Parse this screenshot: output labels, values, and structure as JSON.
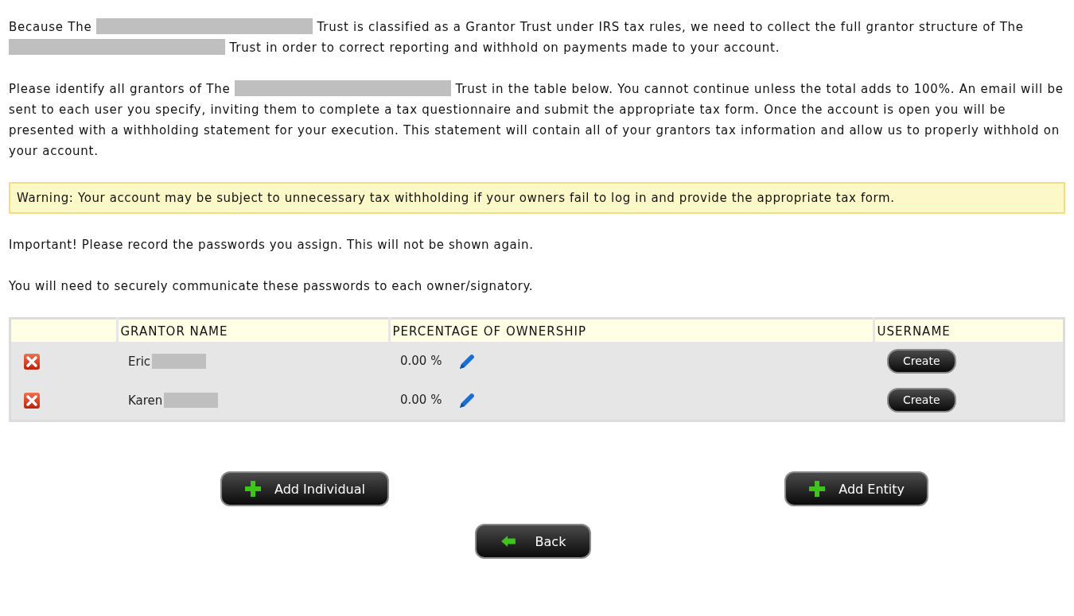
{
  "paragraphs": [
    {
      "segments": [
        {
          "kind": "text",
          "text": "Because The"
        },
        {
          "kind": "redaction"
        },
        {
          "kind": "text",
          "text": "Trust is classified as a Grantor Trust under IRS tax rules, we need to collect the full grantor structure of The"
        },
        {
          "kind": "redaction"
        },
        {
          "kind": "text",
          "text": "Trust in order to correct reporting and withhold on payments made to your account."
        }
      ]
    },
    {
      "segments": [
        {
          "kind": "text",
          "text": "Please identify all grantors of The"
        },
        {
          "kind": "redaction"
        },
        {
          "kind": "text",
          "text": "Trust in the table below. You cannot continue unless the total adds to 100%. An email will be sent to each user you specify, inviting them to complete a tax questionnaire and submit the appropriate tax form. Once the account is open you will be presented with a withholding statement for your execution. This statement will contain all of your grantors tax information and allow us to properly withhold on your account."
        }
      ]
    }
  ],
  "warning": "Warning: Your account may be subject to unnecessary tax withholding if your owners fail to log in and provide the appropriate tax form.",
  "notes": [
    "Important! Please record the passwords you assign. This will not be shown again.",
    "You will need to securely communicate these passwords to each owner/signatory."
  ],
  "table": {
    "columns": [
      "GRANTOR NAME",
      "PERCENTAGE OF OWNERSHIP",
      "USERNAME"
    ],
    "rows": [
      {
        "name": "Eric",
        "percentage": "0.00 %",
        "username_button": "Create"
      },
      {
        "name": "Karen",
        "percentage": "0.00 %",
        "username_button": "Create"
      }
    ]
  },
  "buttons": [
    {
      "label": "Add Individual",
      "kind": "add"
    },
    {
      "label": "Add Entity",
      "kind": "add"
    },
    {
      "label": "Back",
      "kind": "back"
    }
  ]
}
